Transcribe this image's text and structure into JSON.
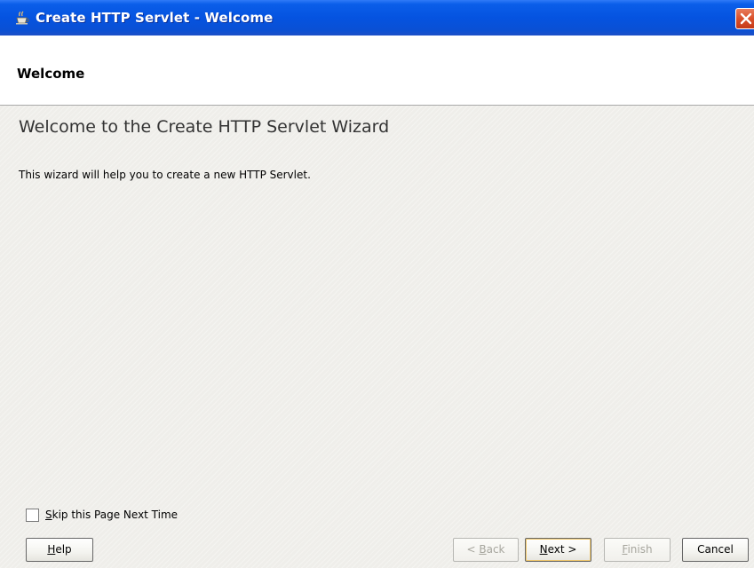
{
  "window": {
    "title": "Create HTTP Servlet - Welcome",
    "app_icon": "jdeveloper-cup-icon",
    "close_icon": "close-icon",
    "colors": {
      "titlebar": "#0553e0",
      "close_button": "#d9502b",
      "content_background": "#efeeea"
    }
  },
  "header": {
    "title": "Welcome"
  },
  "main": {
    "heading": "Welcome to the Create HTTP Servlet Wizard",
    "description": "This wizard will help you to create a new HTTP Servlet."
  },
  "skip_checkbox": {
    "label_mnemonic": "S",
    "label_rest": "kip this Page Next Time",
    "checked": false
  },
  "buttons": {
    "help": {
      "mnemonic": "H",
      "rest": "elp",
      "enabled": true
    },
    "back": {
      "prefix": "< ",
      "mnemonic": "B",
      "rest": "ack",
      "enabled": false
    },
    "next": {
      "mnemonic": "N",
      "rest": "ext >",
      "enabled": true
    },
    "finish": {
      "mnemonic": "F",
      "rest": "inish",
      "enabled": false
    },
    "cancel": {
      "label": "Cancel",
      "enabled": true
    }
  }
}
